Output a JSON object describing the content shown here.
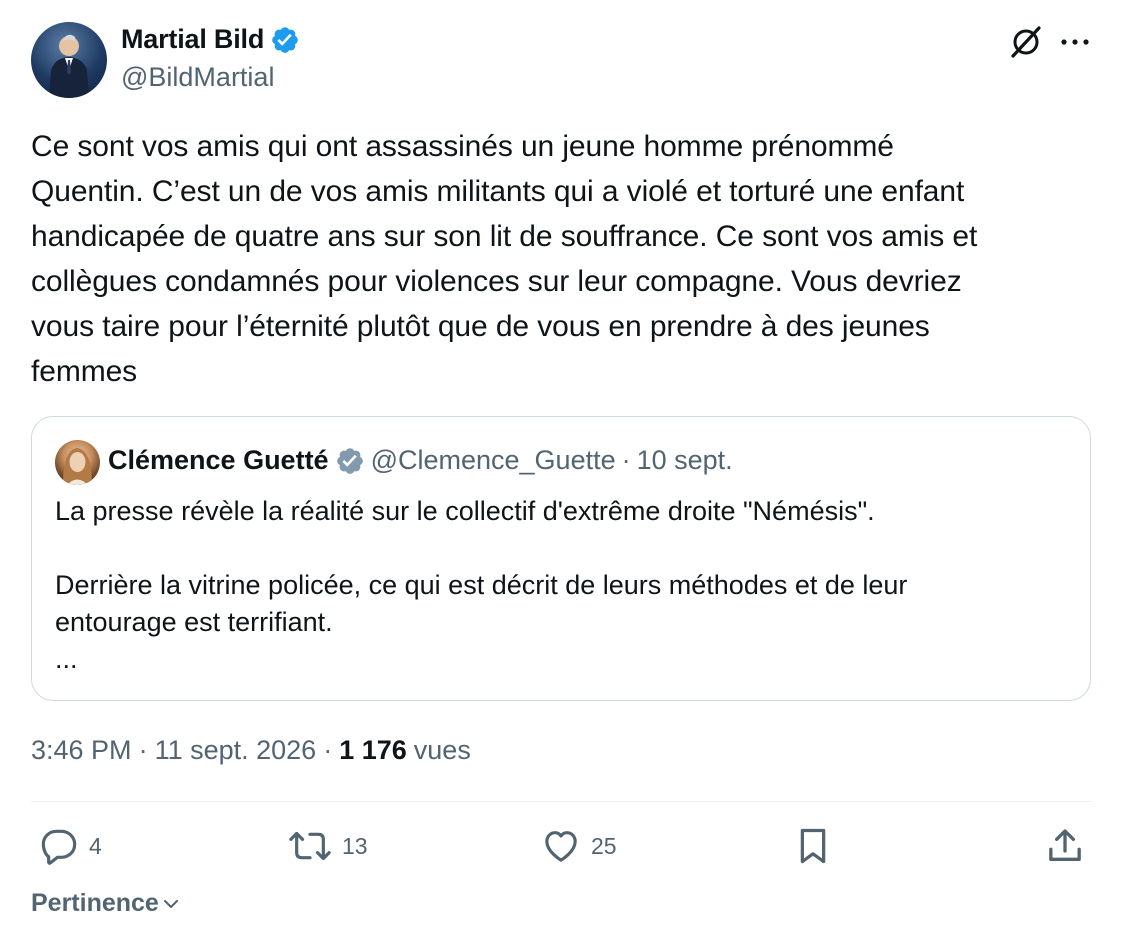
{
  "author": {
    "display_name": "Martial Bild",
    "handle": "@BildMartial"
  },
  "tweet": {
    "text_lines": [
      "Ce sont vos amis qui ont assassinés un jeune homme prénommé",
      "Quentin. C’est un de vos amis militants qui a violé et torturé une enfant",
      "handicapée de quatre ans sur son lit de souffrance. Ce sont vos amis et",
      "collègues condamnés pour violences sur leur compagne. Vous devriez",
      "vous taire pour l’éternité plutôt que de vous en prendre à des jeunes",
      "femmes"
    ],
    "time": "3:46 PM",
    "date": "11 sept. 2026",
    "views_count": "1 176",
    "views_label": "vues",
    "separator": "·"
  },
  "quoted": {
    "display_name": "Clémence Guetté",
    "handle": "@Clemence_Guette",
    "separator": "·",
    "date": "10 sept.",
    "line1": "La presse révèle la réalité sur le collectif d'extrême droite \"Némésis\".",
    "line2": "Derrière la vitrine policée, ce qui est décrit de leurs méthodes et de leur",
    "line3": "entourage est terrifiant.",
    "line4": "..."
  },
  "actions": {
    "replies": "4",
    "reposts": "13",
    "likes": "25"
  },
  "sort": {
    "label": "Pertinence"
  },
  "colors": {
    "verified_blue": "#1d9bf0",
    "verified_gray": "#829aab",
    "secondary_text": "#536471",
    "primary_text": "#0f1419",
    "border": "#cfd9de"
  },
  "icons": [
    "verified-badge-icon",
    "grok-icon",
    "more-icon",
    "reply-icon",
    "repost-icon",
    "like-icon",
    "bookmark-icon",
    "share-icon",
    "chevron-down-icon"
  ]
}
